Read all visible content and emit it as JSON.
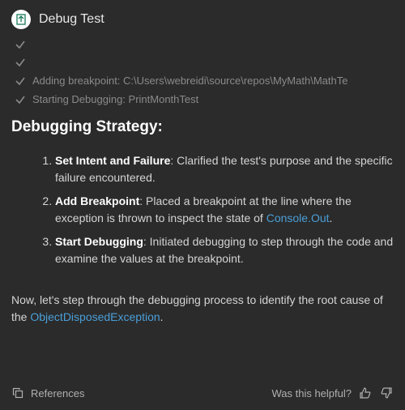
{
  "header": {
    "title": "Debug Test"
  },
  "progress": {
    "items": [
      {
        "label": ""
      },
      {
        "label": ""
      },
      {
        "label": "Adding breakpoint: C:\\Users\\webreidi\\source\\repos\\MyMath\\MathTe"
      },
      {
        "label": "Starting Debugging: PrintMonthTest"
      }
    ]
  },
  "strategy": {
    "heading": "Debugging Strategy:",
    "steps": [
      {
        "title": "Set Intent and Failure",
        "desc_before": ": Clarified the test's purpose and the specific failure encountered.",
        "link": "",
        "desc_after": ""
      },
      {
        "title": "Add Breakpoint",
        "desc_before": ": Placed a breakpoint at the line where the exception is thrown to inspect the state of ",
        "link": "Console.Out",
        "desc_after": "."
      },
      {
        "title": "Start Debugging",
        "desc_before": ": Initiated debugging to step through the code and examine the values at the breakpoint.",
        "link": "",
        "desc_after": ""
      }
    ]
  },
  "followup": {
    "text_before": "Now, let's step through the debugging process to identify the root cause of the ",
    "link": "ObjectDisposedException",
    "text_after": "."
  },
  "footer": {
    "references": "References",
    "helpful_prompt": "Was this helpful?"
  }
}
